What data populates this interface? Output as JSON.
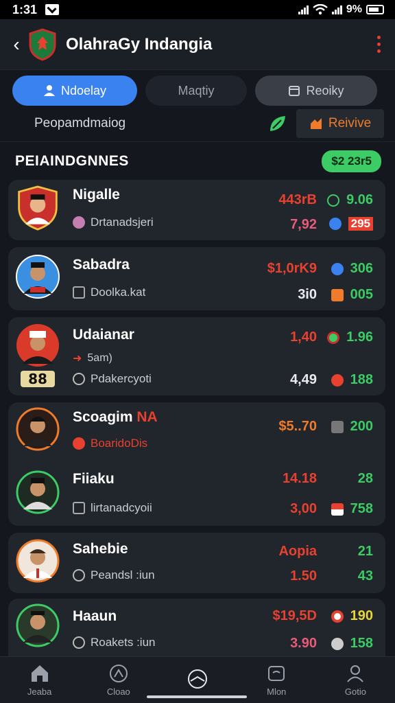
{
  "status": {
    "time": "1:31",
    "battery": "9%"
  },
  "header": {
    "title": "OlahraGy Indangia"
  },
  "tabs": [
    {
      "label": "Ndoelay"
    },
    {
      "label": "Maqtiy"
    },
    {
      "label": "Reoiky"
    }
  ],
  "subbar": {
    "label": "Peopamdmaiog",
    "receive_label": "Reivive"
  },
  "section": {
    "title": "PEIAINDGNNES",
    "balance": "$2 23r5"
  },
  "players": [
    {
      "name": "Nigalle",
      "sub": "Drtanadsjeri",
      "top_a": "443rB",
      "top_b": "9.06",
      "bot_a": "7,92",
      "bot_b": "295"
    },
    {
      "name": "Sabadra",
      "sub": "Doolka.kat",
      "top_a": "$1,0rK9",
      "top_b": "306",
      "bot_a": "3i0",
      "bot_b": "005"
    },
    {
      "name": "Udaianar",
      "sub": "Pdakercyoti",
      "extra": "5am)",
      "top_a": "1,40",
      "top_b": "1.96",
      "bot_a": "4,49",
      "bot_b": "188"
    },
    {
      "name": "Scoagim",
      "name_tag": "NA",
      "sub": "BoaridoDis",
      "top_a": "$5..70",
      "top_b": "200",
      "bot_a": "",
      "bot_b": ""
    },
    {
      "name": "Fiiaku",
      "sub": "lirtanadcyoii",
      "top_a": "14.18",
      "top_b": "28",
      "bot_a": "3,00",
      "bot_b": "758"
    },
    {
      "name": "Sahebie",
      "sub": "Peandsl :iun",
      "top_a": "Aopia",
      "top_b": "21",
      "bot_a": "1.50",
      "bot_b": "43"
    },
    {
      "name": "Haaun",
      "sub": "Roakets :iun",
      "top_a": "$19,5D",
      "top_b": "190",
      "bot_a": "3.90",
      "bot_b": "158"
    }
  ],
  "nav": [
    {
      "label": "Jeaba",
      "icon": "home-icon"
    },
    {
      "label": "Cloao",
      "icon": "ball-icon"
    },
    {
      "label": "",
      "icon": "center-icon"
    },
    {
      "label": "Mlon",
      "icon": "chat-icon"
    },
    {
      "label": "Gotio",
      "icon": "profile-icon"
    }
  ],
  "colors": {
    "accent_blue": "#3a82f0",
    "red": "#e8412f",
    "green": "#3ccb64",
    "orange": "#f07b2a"
  }
}
